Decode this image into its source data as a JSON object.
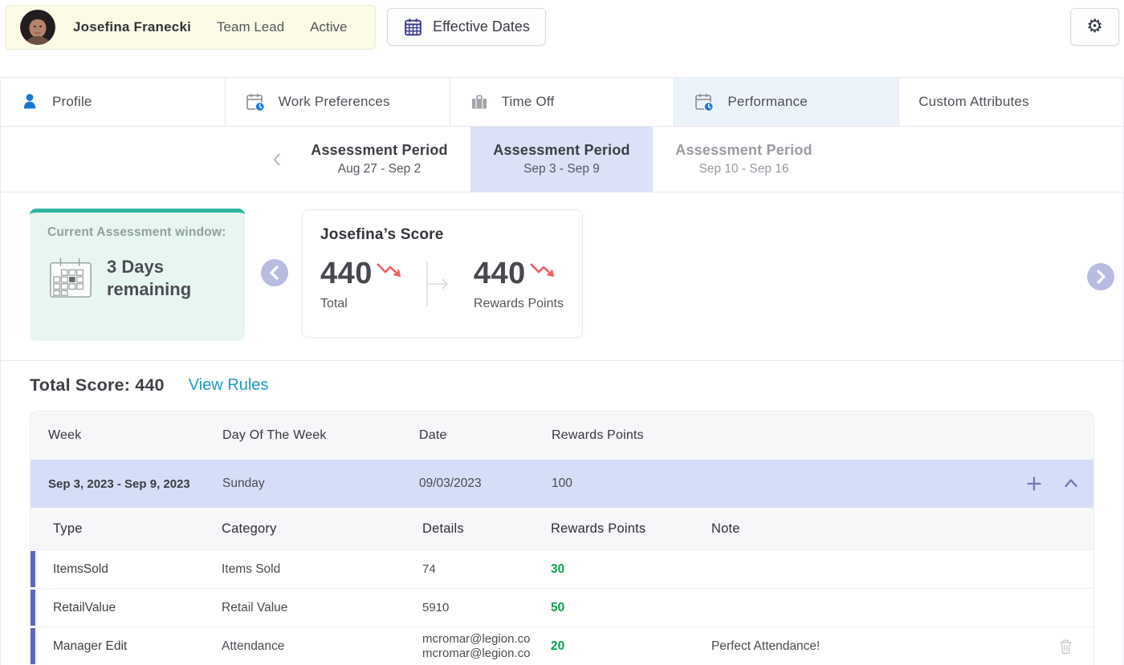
{
  "user_bar": {
    "name": "Josefina Franecki",
    "role": "Team Lead",
    "status": "Active",
    "effective_dates_label": "Effective Dates"
  },
  "tabs": [
    {
      "label": "Profile",
      "icon": "person-icon",
      "selected": false
    },
    {
      "label": "Work Preferences",
      "icon": "calendar-clock-icon",
      "selected": false
    },
    {
      "label": "Time Off",
      "icon": "briefcase-icon",
      "selected": false
    },
    {
      "label": "Performance",
      "icon": "calendar-clock-icon",
      "selected": true
    },
    {
      "label": "Custom Attributes",
      "icon": "none",
      "selected": false
    }
  ],
  "assessment_periods": [
    {
      "title": "Assessment Period",
      "range": "Aug 27 - Sep 2",
      "state": "past"
    },
    {
      "title": "Assessment Period",
      "range": "Sep 3 - Sep 9",
      "state": "selected"
    },
    {
      "title": "Assessment Period",
      "range": "Sep 10 - Sep 16",
      "state": "future"
    }
  ],
  "assessment_window": {
    "label": "Current Assessment window:",
    "remaining": "3 Days\nremaining"
  },
  "score_card": {
    "title": "Josefina’s Score",
    "total": {
      "value": "440",
      "label": "Total",
      "trend": "down"
    },
    "rewards": {
      "value": "440",
      "label": "Rewards Points",
      "trend": "down"
    }
  },
  "summary": {
    "total_score_label": "Total Score: 440",
    "view_rules_label": "View Rules"
  },
  "week_table": {
    "headers": [
      "Week",
      "Day Of The Week",
      "Date",
      "Rewards Points"
    ],
    "row": {
      "week": "Sep 3, 2023 - Sep 9, 2023",
      "day": "Sunday",
      "date": "09/03/2023",
      "points": "100"
    }
  },
  "detail_table": {
    "headers": [
      "Type",
      "Category",
      "Details",
      "Rewards Points",
      "Note"
    ],
    "rows": [
      {
        "type": "ItemsSold",
        "category": "Items Sold",
        "details": "74",
        "points": "30",
        "note": ""
      },
      {
        "type": "RetailValue",
        "category": "Retail Value",
        "details": "5910",
        "points": "50",
        "note": ""
      },
      {
        "type": "Manager Edit",
        "category": "Attendance",
        "details": "mcromar@legion.co\nmcromar@legion.co",
        "points": "20",
        "note": "Perfect Attendance!"
      }
    ]
  },
  "icons": {
    "gear": "⚙",
    "person": "svg-blue-user-silhouette",
    "calendar_clock": "svg-calendar-with-blue-clock",
    "briefcase": "svg-gray-briefcase",
    "calendar_grid": "svg-indigo-calendar",
    "calendar_large": "svg-outline-calendar-one-day-marked",
    "trend_down": "svg-red-zigzag-arrow",
    "score_divider": "svg-bar-with-right-arrow",
    "chevron_left": "svg-chevron-left",
    "chevron_right": "svg-chevron-right",
    "plus": "svg-plus",
    "collapse": "svg-chevron-up",
    "trash": "svg-trash-outline"
  },
  "colors": {
    "chip-yellow": "#fbfbe6",
    "accent-blue": "#1b76d2",
    "clock-blue": "#1f7ce0",
    "selected-tab-bg": "#edf3fa",
    "period-selected-bg": "#dbe2f7",
    "teal": "#2eb6a4",
    "teal-bg": "#e8f6f2",
    "lavender": "#b9bce1",
    "trend-red": "#ee5f5f",
    "points-green": "#0f9f4f",
    "indigo": "#5b6abc",
    "icon-indigo": "#6b78b7",
    "link-blue": "#2297cb",
    "week-row-bg": "#d6ddf6",
    "header-row-bg": "#f7f7fa",
    "calendar-indigo": "#3c3c90"
  }
}
